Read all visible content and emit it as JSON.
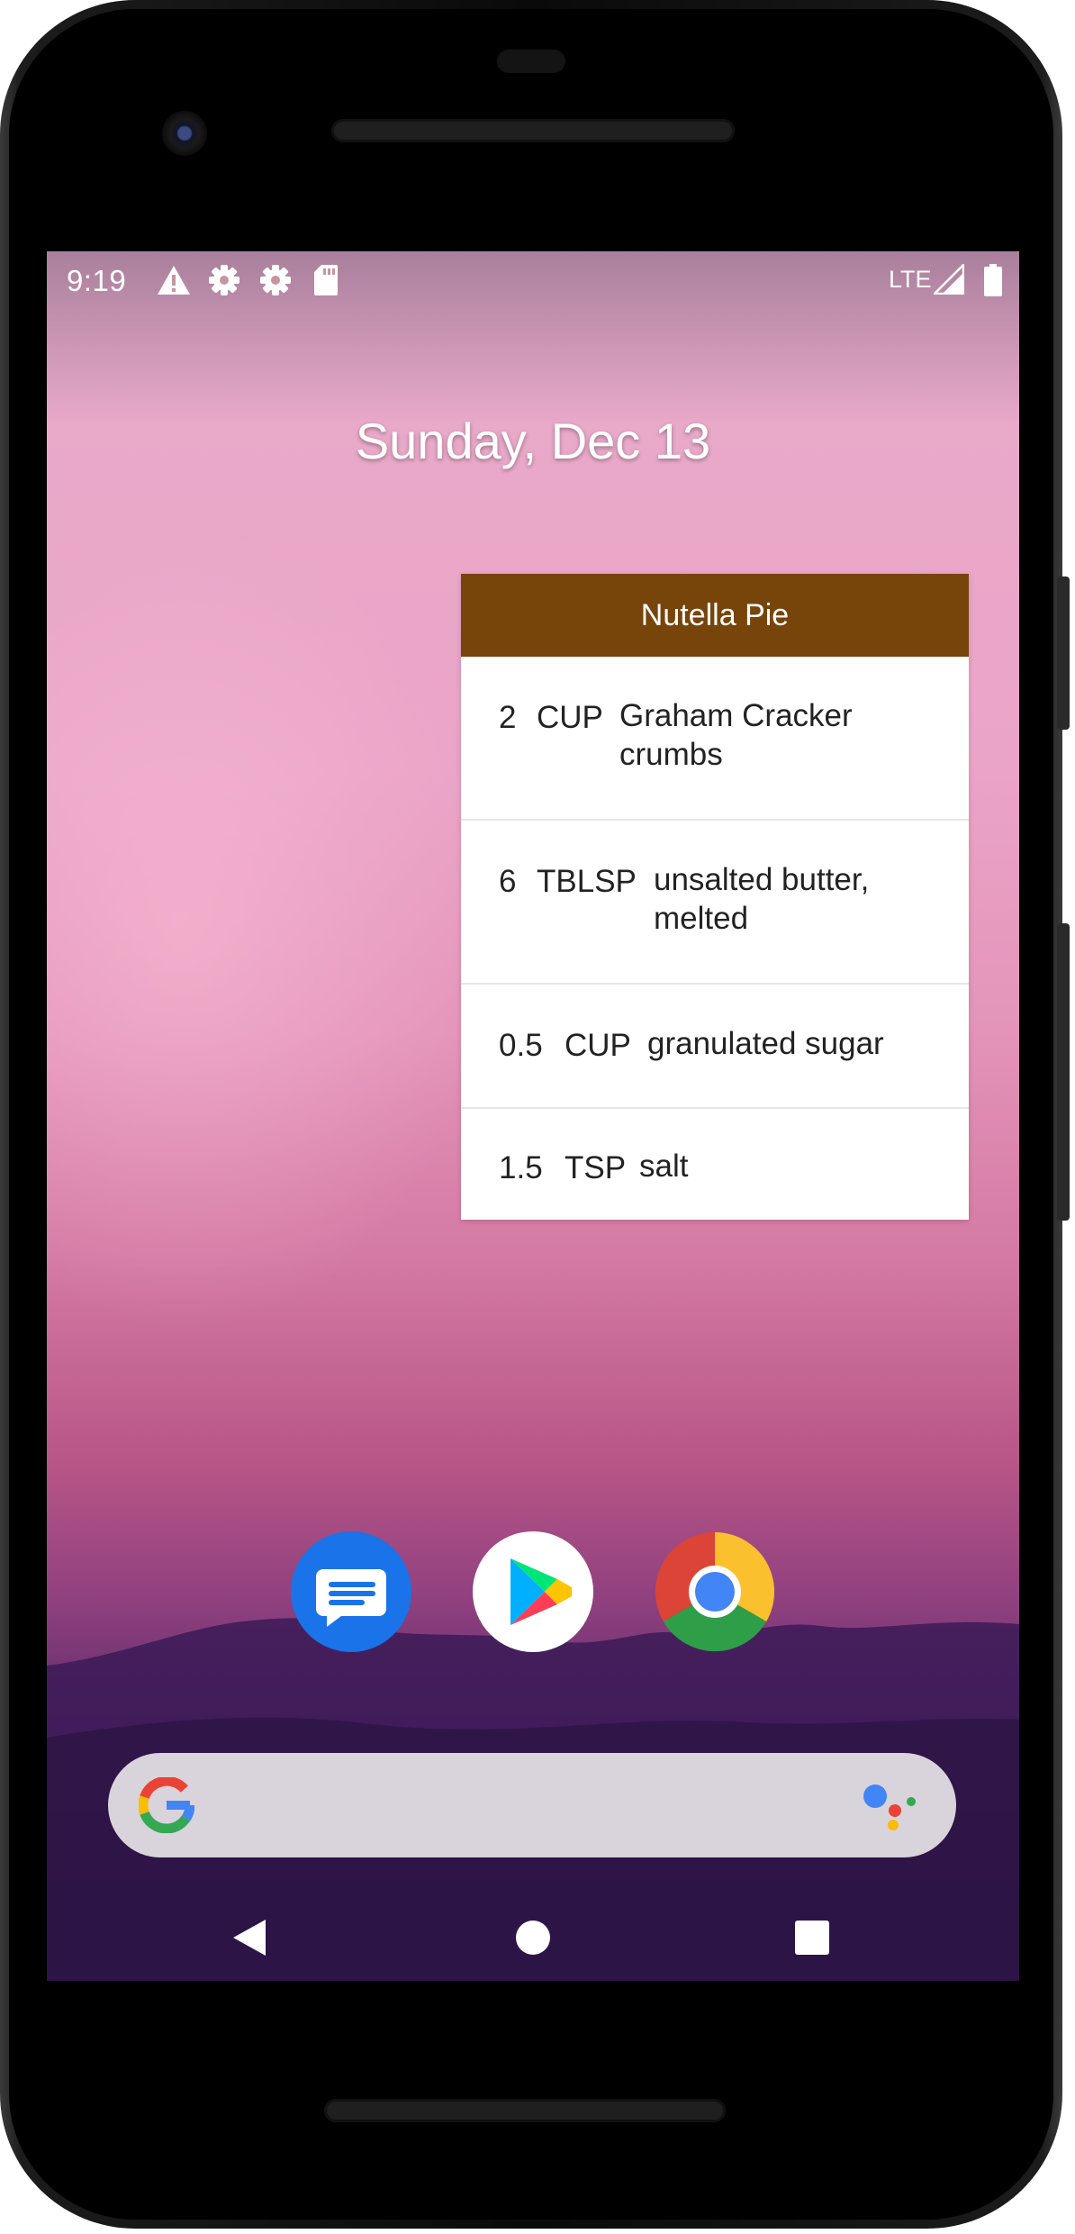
{
  "status_bar": {
    "time": "9:19",
    "network": "LTE",
    "icons": [
      "warning-icon",
      "settings-icon",
      "settings-icon",
      "sd-card-icon",
      "signal-icon",
      "battery-icon"
    ]
  },
  "home": {
    "date": "Sunday, Dec 13"
  },
  "widget": {
    "title": "Nutella Pie",
    "header_color": "#77440a",
    "ingredients": [
      {
        "qty": "2",
        "unit": "CUP",
        "name_lines": [
          "Graham Cracker",
          "crumbs"
        ]
      },
      {
        "qty": "6",
        "unit": "TBLSP",
        "name_lines": [
          "unsalted butter,",
          "melted"
        ]
      },
      {
        "qty": "0.5",
        "unit": "CUP",
        "name_lines": [
          "granulated sugar"
        ]
      },
      {
        "qty": "1.5",
        "unit": "TSP",
        "name_lines": [
          "salt"
        ]
      }
    ]
  },
  "dock": {
    "apps": [
      "messages-icon",
      "play-store-icon",
      "chrome-icon"
    ]
  },
  "search_bar": {
    "icons": [
      "google-logo-icon",
      "assistant-icon"
    ]
  },
  "nav_bar": {
    "buttons": [
      "back-button",
      "home-button",
      "recents-button"
    ]
  }
}
